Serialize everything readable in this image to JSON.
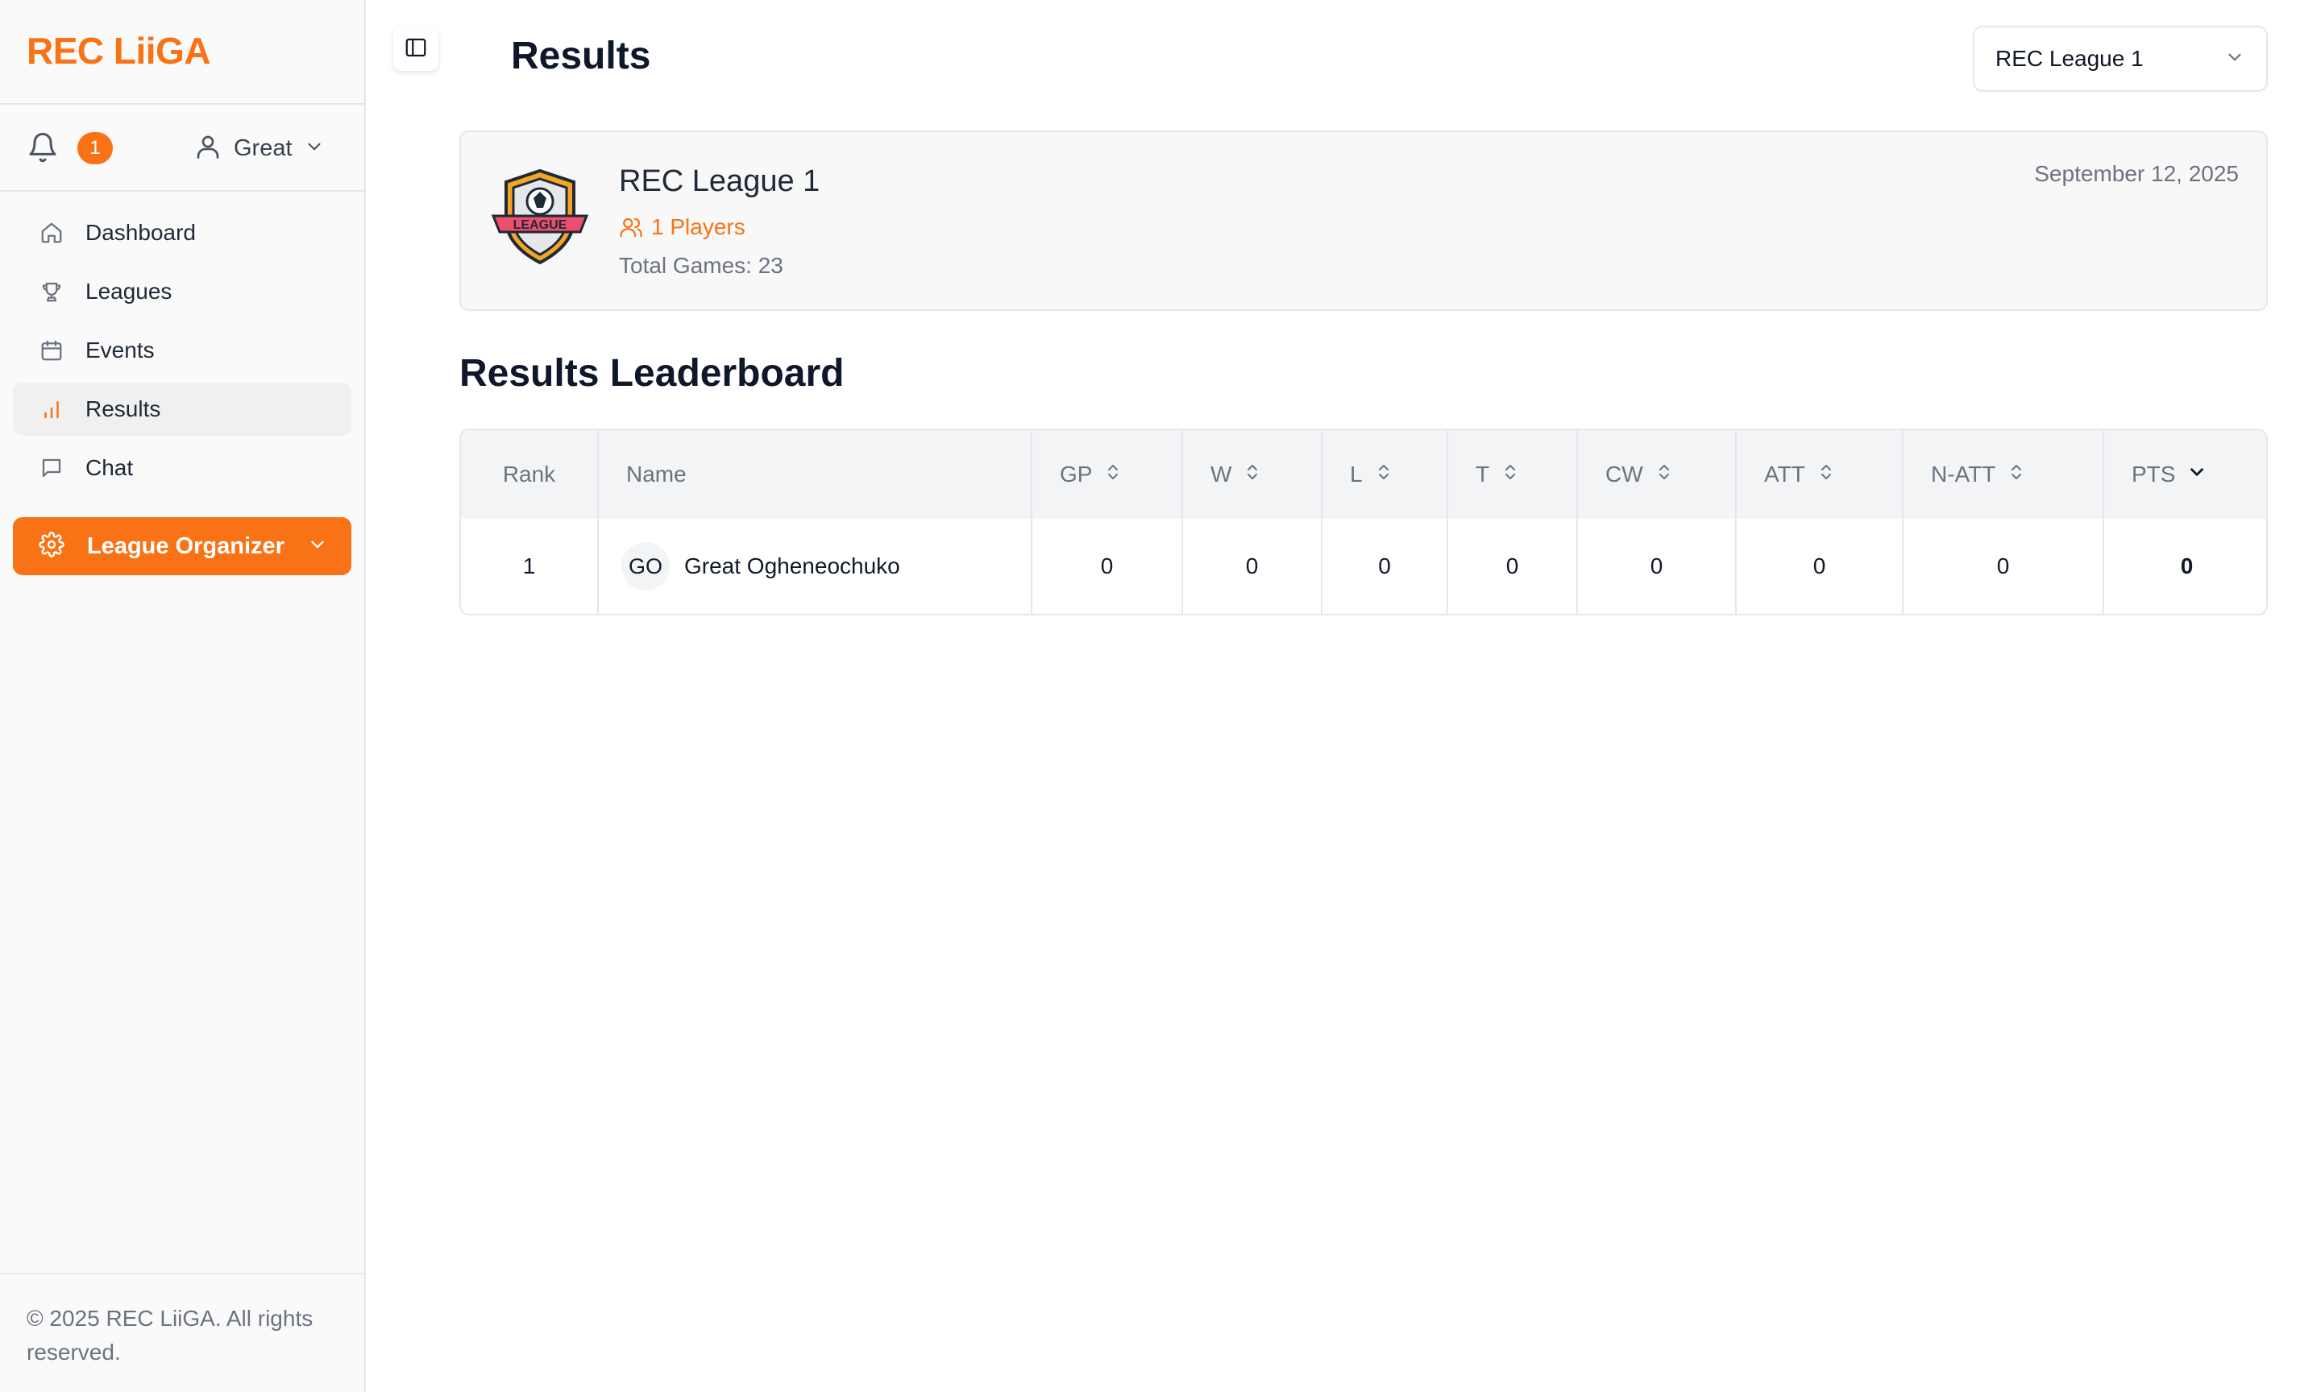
{
  "brand": {
    "name": "REC LiiGA",
    "color": "#f97316"
  },
  "header": {
    "notifications_count": "1",
    "user_name": "Great"
  },
  "sidebar": {
    "items": [
      {
        "label": "Dashboard",
        "icon": "home-icon"
      },
      {
        "label": "Leagues",
        "icon": "trophy-icon"
      },
      {
        "label": "Events",
        "icon": "calendar-icon"
      },
      {
        "label": "Results",
        "icon": "bar-chart-icon",
        "active": true
      },
      {
        "label": "Chat",
        "icon": "message-icon"
      }
    ],
    "organizer_label": "League Organizer",
    "footer": "© 2025 REC LiiGA. All rights reserved."
  },
  "page": {
    "title": "Results",
    "league_select": "REC League 1"
  },
  "league_card": {
    "name": "REC League 1",
    "players": "1 Players",
    "total_games": "Total Games: 23",
    "date": "September 12, 2025",
    "logo_text": "LEAGUE"
  },
  "leaderboard": {
    "title": "Results Leaderboard",
    "columns": [
      "Rank",
      "Name",
      "GP",
      "W",
      "L",
      "T",
      "CW",
      "ATT",
      "N-ATT",
      "PTS"
    ],
    "rows": [
      {
        "rank": "1",
        "initials": "GO",
        "name": "Great Ogheneochuko",
        "gp": "0",
        "w": "0",
        "l": "0",
        "t": "0",
        "cw": "0",
        "att": "0",
        "natt": "0",
        "pts": "0"
      }
    ]
  }
}
